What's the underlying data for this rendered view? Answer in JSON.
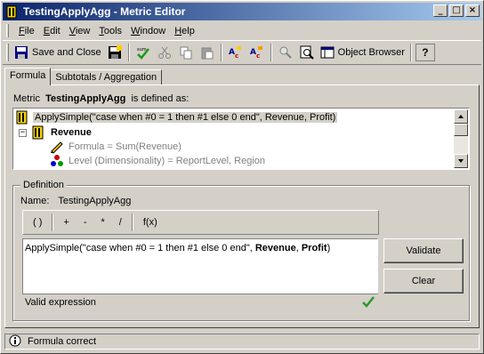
{
  "window": {
    "title": "TestingApplyAgg - Metric Editor",
    "minimize": "_",
    "maximize": "□",
    "close": "×"
  },
  "menu": [
    {
      "label": "File",
      "accel": "F",
      "rest": "ile"
    },
    {
      "label": "Edit",
      "accel": "E",
      "rest": "dit"
    },
    {
      "label": "View",
      "accel": "V",
      "rest": "iew"
    },
    {
      "label": "Tools",
      "accel": "T",
      "rest": "ools"
    },
    {
      "label": "Window",
      "accel": "W",
      "rest": "indow"
    },
    {
      "label": "Help",
      "accel": "H",
      "rest": "elp"
    }
  ],
  "toolbar": {
    "save_and_close": "Save and Close",
    "object_browser": "Object Browser",
    "help": "?"
  },
  "tabs": [
    {
      "label": "Formula",
      "active": true
    },
    {
      "label": "Subtotals / Aggregation",
      "active": false
    }
  ],
  "formula": {
    "prefix": "Metric",
    "metric_name": "TestingApplyAgg",
    "suffix": "is defined as:"
  },
  "tree": {
    "rows": [
      {
        "text": "ApplySimple(\"case when #0 = 1 then #1 else 0 end\", Revenue, Profit)",
        "selected": true
      },
      {
        "text": "Revenue",
        "expander": "−"
      },
      {
        "text": "Formula = Sum(Revenue)"
      },
      {
        "text": "Level (Dimensionality) = ReportLevel, Region"
      }
    ]
  },
  "definition": {
    "group_label": "Definition",
    "name_label": "Name:",
    "name_value": "TestingApplyAgg",
    "operators": [
      "( )",
      "+",
      "-",
      "*",
      "/",
      "f(x)"
    ],
    "expression_prefix": "ApplySimple(\"case when #0 = 1 then #1 else 0 end\", ",
    "expression_arg1": "Revenue",
    "expression_comma": ", ",
    "expression_arg2": "Profit",
    "expression_suffix": ")",
    "validation_status": "Valid expression",
    "validate_button": "Validate",
    "clear_button": "Clear"
  },
  "statusbar": {
    "message": "Formula correct"
  },
  "colors": {
    "title_start": "#0a246a",
    "title_end": "#a6caf0",
    "face": "#d4d0c8",
    "check": "#2a9a2a"
  }
}
